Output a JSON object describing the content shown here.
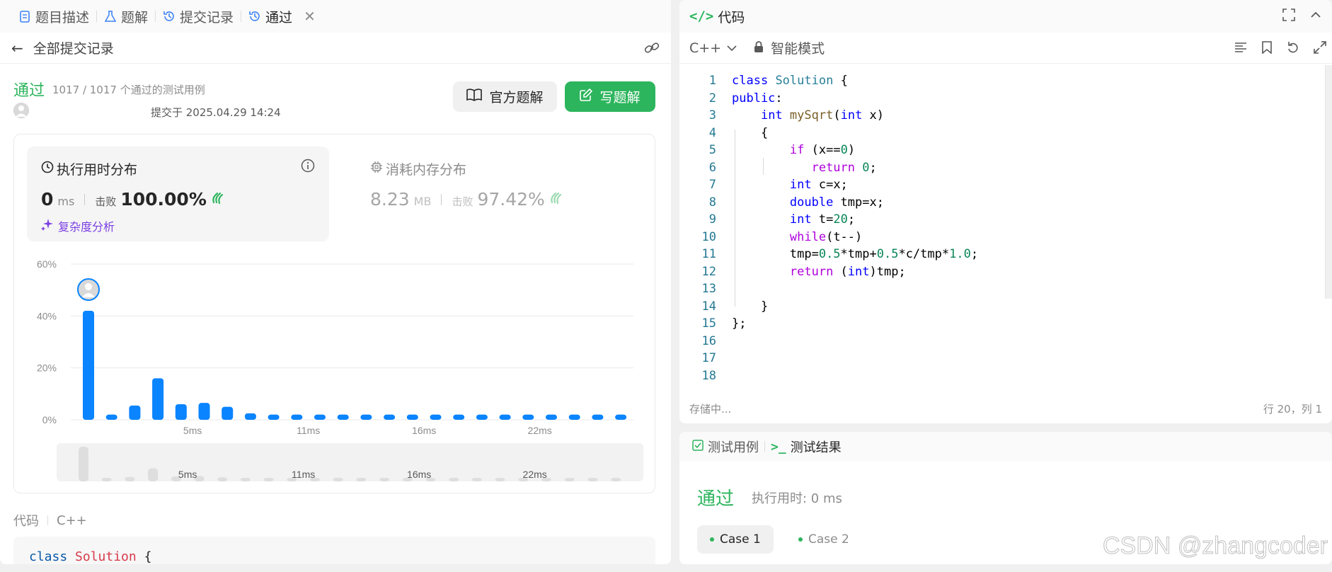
{
  "left_tabs": [
    {
      "label": "题目描述",
      "icon": "document-icon"
    },
    {
      "label": "题解",
      "icon": "flask-icon"
    },
    {
      "label": "提交记录",
      "icon": "history-icon"
    },
    {
      "label": "通过",
      "icon": "history-icon",
      "active": true
    }
  ],
  "submissions": {
    "back_label": "全部提交记录"
  },
  "result": {
    "status": "通过",
    "cases_desc": "1017 / 1017 个通过的测试用例",
    "submitted_at": "提交于 2025.04.29 14:24",
    "official_solution_label": "官方题解",
    "write_solution_label": "写题解"
  },
  "runtime": {
    "title": "执行用时分布",
    "value": "0",
    "unit": "ms",
    "beat_label": "击败",
    "beat_pct": "100.00%",
    "complexity_label": "复杂度分析"
  },
  "memory": {
    "title": "消耗内存分布",
    "value": "8.23",
    "unit": "MB",
    "beat_label": "击败",
    "beat_pct": "97.42%"
  },
  "chart_data": {
    "type": "bar",
    "y_ticks": [
      "60%",
      "40%",
      "20%",
      "0%"
    ],
    "ylim": [
      0,
      60
    ],
    "x_tick_labels": [
      {
        "index": 5,
        "label": "5ms"
      },
      {
        "index": 10,
        "label": "11ms"
      },
      {
        "index": 15,
        "label": "16ms"
      },
      {
        "index": 20,
        "label": "22ms"
      }
    ],
    "values": [
      42,
      2,
      5.5,
      16,
      6,
      6.5,
      5,
      2.5,
      2,
      2,
      2,
      2,
      2,
      2,
      2,
      2,
      2,
      2,
      2,
      2,
      2,
      2,
      2,
      2
    ],
    "highlight_index": 0,
    "grid": true,
    "bar_color": "#0a84ff"
  },
  "minimap": {
    "labels": [
      "5ms",
      "11ms",
      "16ms",
      "22ms"
    ]
  },
  "code_section": {
    "label": "代码",
    "language": "C++",
    "preview_kw": "class",
    "preview_name": "Solution",
    "preview_brace": "{"
  },
  "editor": {
    "title": "代码",
    "language": "C++",
    "mode": "智能模式",
    "status": "存储中...",
    "position": "行 20，列 1",
    "lines": [
      "1",
      "2",
      "3",
      "4",
      "5",
      "6",
      "7",
      "8",
      "9",
      "10",
      "11",
      "12",
      "13",
      "14",
      "15",
      "16",
      "17",
      "18"
    ]
  },
  "test_panel": {
    "tab_cases": "测试用例",
    "tab_result": "测试结果",
    "status": "通过",
    "runtime": "执行用时: 0 ms",
    "cases": [
      "Case 1",
      "Case 2"
    ]
  },
  "watermark": "CSDN @zhangcoder"
}
